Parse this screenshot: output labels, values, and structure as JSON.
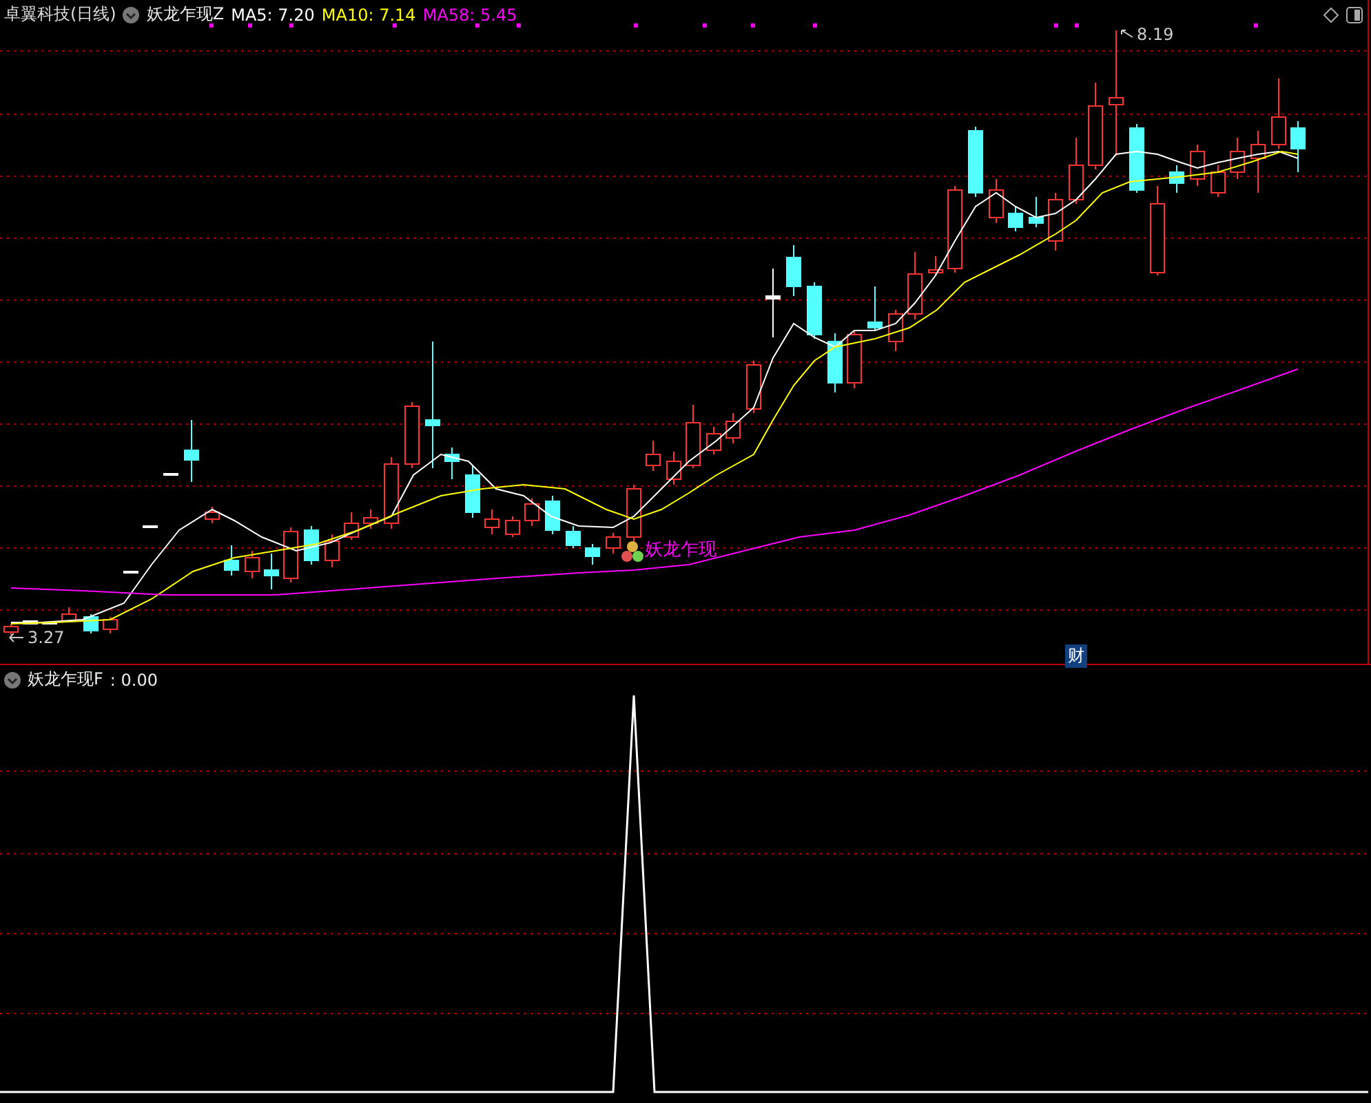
{
  "main_panel": {
    "title": "卓翼科技(日线)",
    "indicator": "妖龙乍现Z",
    "legends": [
      {
        "label": "MA5:",
        "value": "7.20",
        "color": "#ffffff"
      },
      {
        "label": "MA10:",
        "value": "7.14",
        "color": "#ffff00"
      },
      {
        "label": "MA58:",
        "value": "5.45",
        "color": "#ff00ff"
      }
    ],
    "high_marker": "8.19",
    "low_marker": "3.27",
    "signal_label": "妖龙乍现",
    "finance_badge": "财"
  },
  "sub_panel": {
    "indicator": "妖龙乍现F",
    "reading": ": 0.00"
  }
}
